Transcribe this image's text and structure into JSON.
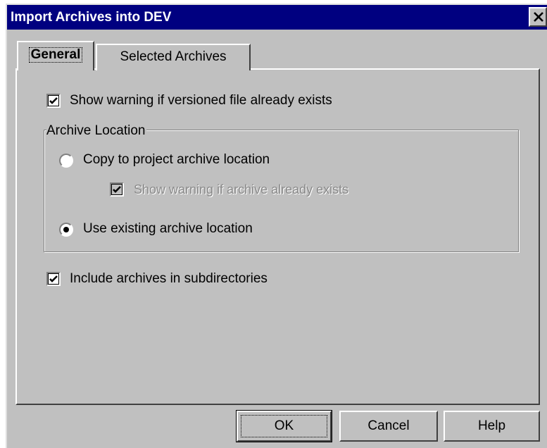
{
  "window": {
    "title": "Import Archives into DEV",
    "close_icon": "close-icon"
  },
  "tabs": [
    {
      "label": "General",
      "selected": true
    },
    {
      "label": "Selected Archives",
      "selected": false
    }
  ],
  "general": {
    "show_warning_versioned": {
      "label": "Show warning if versioned file already exists",
      "checked": true
    },
    "archive_location": {
      "legend": "Archive Location",
      "copy_to_project": {
        "label": "Copy to project archive location",
        "selected": false
      },
      "show_warning_archive": {
        "label": "Show warning if archive already exists",
        "checked": true,
        "disabled": true
      },
      "use_existing": {
        "label": "Use existing archive location",
        "selected": true
      }
    },
    "include_subdirectories": {
      "label": "Include archives in subdirectories",
      "checked": true
    }
  },
  "buttons": {
    "ok": "OK",
    "cancel": "Cancel",
    "help": "Help"
  }
}
